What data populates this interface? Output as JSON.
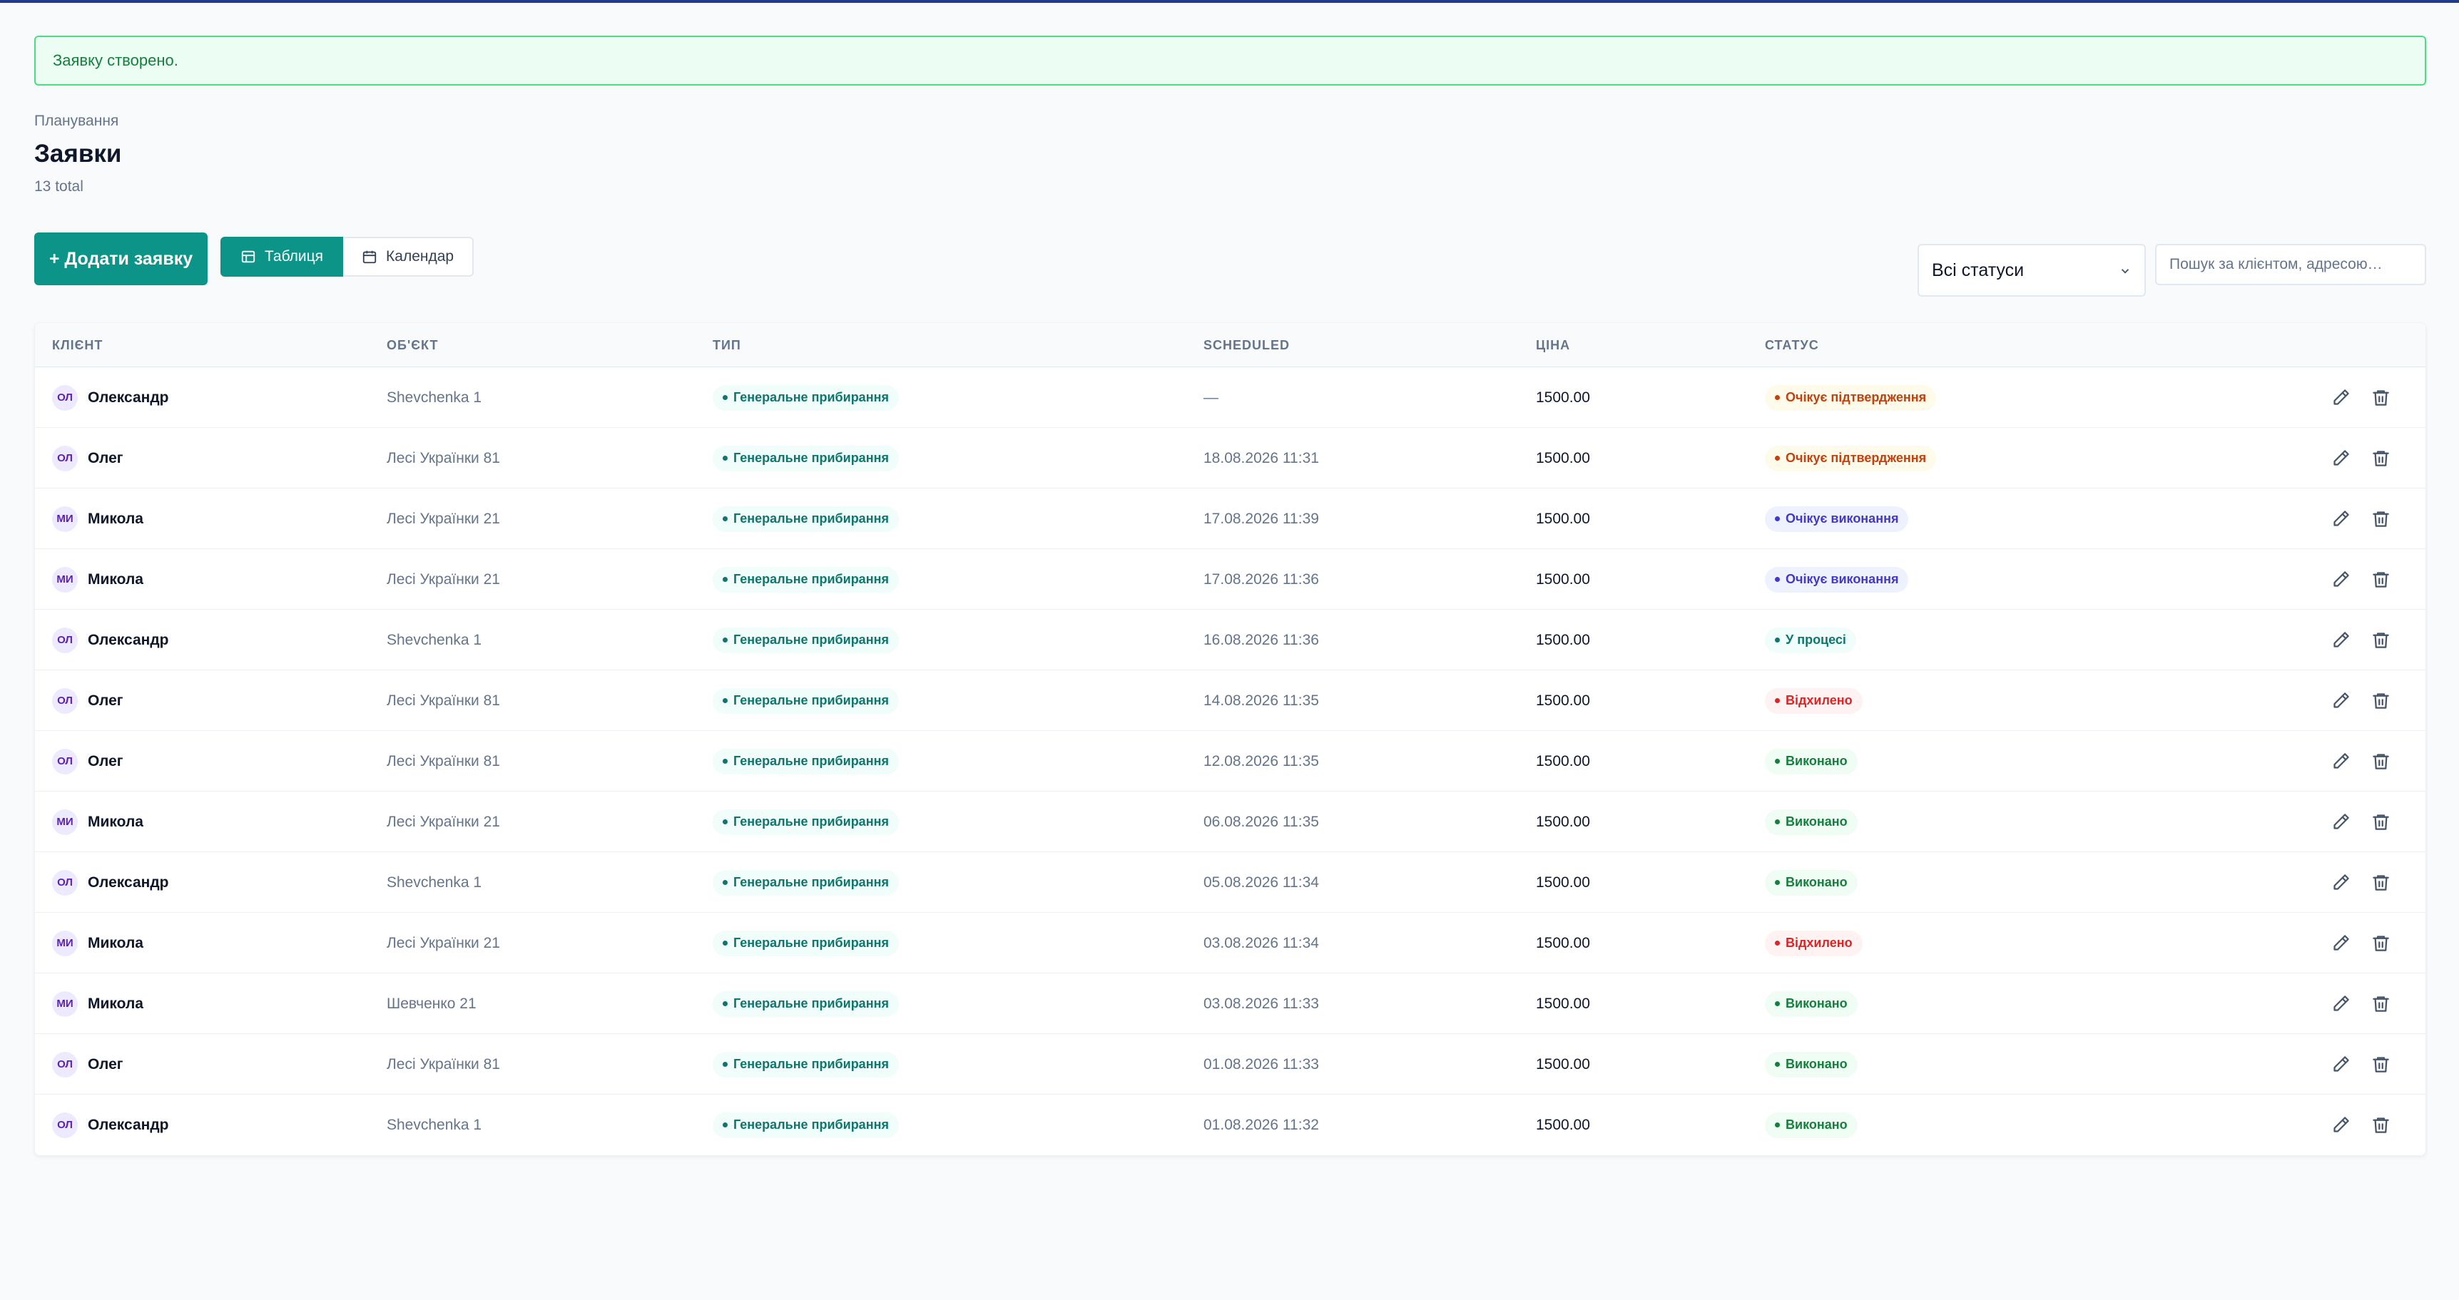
{
  "alert": {
    "text": "Заявку створено."
  },
  "header": {
    "breadcrumb": "Планування",
    "title": "Заявки",
    "total": "13 total"
  },
  "toolbar": {
    "add_label": "+ Додати заявку",
    "view_table_label": "Таблиця",
    "view_calendar_label": "Календар",
    "status_filter_value": "Всі статуси",
    "search_placeholder": "Пошук за клієнтом, адресою…"
  },
  "table": {
    "columns": [
      "КЛІЄНТ",
      "ОБ'ЄКТ",
      "ТИП",
      "SCHEDULED",
      "ЦІНА",
      "СТАТУС"
    ],
    "rows": [
      {
        "initials": "ОЛ",
        "client": "Олександр",
        "object": "Shevchenka 1",
        "type": "Генеральне прибирання",
        "scheduled": "—",
        "price": "1500.00",
        "status": "Очікує підтвердження",
        "status_tone": "amber"
      },
      {
        "initials": "ОЛ",
        "client": "Олег",
        "object": "Лесі Українки 81",
        "type": "Генеральне прибирання",
        "scheduled": "18.08.2026 11:31",
        "price": "1500.00",
        "status": "Очікує підтвердження",
        "status_tone": "amber"
      },
      {
        "initials": "МИ",
        "client": "Микола",
        "object": "Лесі Українки 21",
        "type": "Генеральне прибирання",
        "scheduled": "17.08.2026 11:39",
        "price": "1500.00",
        "status": "Очікує виконання",
        "status_tone": "indigo"
      },
      {
        "initials": "МИ",
        "client": "Микола",
        "object": "Лесі Українки 21",
        "type": "Генеральне прибирання",
        "scheduled": "17.08.2026 11:36",
        "price": "1500.00",
        "status": "Очікує виконання",
        "status_tone": "indigo"
      },
      {
        "initials": "ОЛ",
        "client": "Олександр",
        "object": "Shevchenka 1",
        "type": "Генеральне прибирання",
        "scheduled": "16.08.2026 11:36",
        "price": "1500.00",
        "status": "У процесі",
        "status_tone": "teal"
      },
      {
        "initials": "ОЛ",
        "client": "Олег",
        "object": "Лесі Українки 81",
        "type": "Генеральне прибирання",
        "scheduled": "14.08.2026 11:35",
        "price": "1500.00",
        "status": "Відхилено",
        "status_tone": "red"
      },
      {
        "initials": "ОЛ",
        "client": "Олег",
        "object": "Лесі Українки 81",
        "type": "Генеральне прибирання",
        "scheduled": "12.08.2026 11:35",
        "price": "1500.00",
        "status": "Виконано",
        "status_tone": "green"
      },
      {
        "initials": "МИ",
        "client": "Микола",
        "object": "Лесі Українки 21",
        "type": "Генеральне прибирання",
        "scheduled": "06.08.2026 11:35",
        "price": "1500.00",
        "status": "Виконано",
        "status_tone": "green"
      },
      {
        "initials": "ОЛ",
        "client": "Олександр",
        "object": "Shevchenka 1",
        "type": "Генеральне прибирання",
        "scheduled": "05.08.2026 11:34",
        "price": "1500.00",
        "status": "Виконано",
        "status_tone": "green"
      },
      {
        "initials": "МИ",
        "client": "Микола",
        "object": "Лесі Українки 21",
        "type": "Генеральне прибирання",
        "scheduled": "03.08.2026 11:34",
        "price": "1500.00",
        "status": "Відхилено",
        "status_tone": "red"
      },
      {
        "initials": "МИ",
        "client": "Микола",
        "object": "Шевченко 21",
        "type": "Генеральне прибирання",
        "scheduled": "03.08.2026 11:33",
        "price": "1500.00",
        "status": "Виконано",
        "status_tone": "green"
      },
      {
        "initials": "ОЛ",
        "client": "Олег",
        "object": "Лесі Українки 81",
        "type": "Генеральне прибирання",
        "scheduled": "01.08.2026 11:33",
        "price": "1500.00",
        "status": "Виконано",
        "status_tone": "green"
      },
      {
        "initials": "ОЛ",
        "client": "Олександр",
        "object": "Shevchenka 1",
        "type": "Генеральне прибирання",
        "scheduled": "01.08.2026 11:32",
        "price": "1500.00",
        "status": "Виконано",
        "status_tone": "green"
      }
    ]
  },
  "icons": {
    "edit": "pencil-icon",
    "delete": "trash-icon",
    "table_view": "table-icon",
    "calendar_view": "calendar-icon",
    "select": "chevron-down-icon"
  },
  "colors": {
    "accent": "#0d9488",
    "topbar": "#1e3a8a",
    "alert_border": "#4ade80"
  }
}
